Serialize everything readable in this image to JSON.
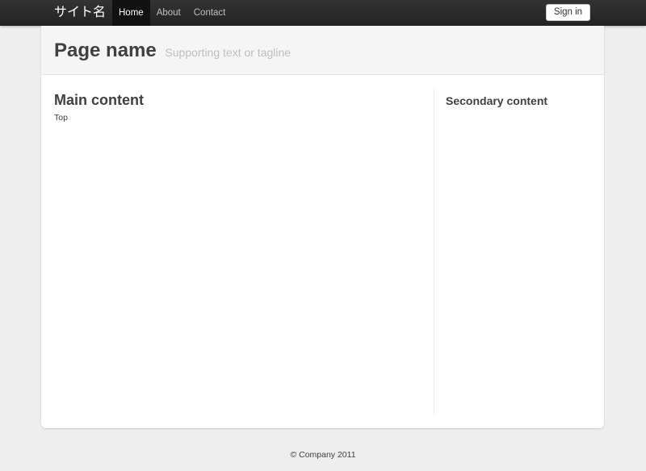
{
  "topbar": {
    "brand": "サイト名",
    "nav": [
      {
        "label": "Home",
        "active": true
      },
      {
        "label": "About",
        "active": false
      },
      {
        "label": "Contact",
        "active": false
      }
    ],
    "signin_label": "Sign in"
  },
  "page_header": {
    "title": "Page name",
    "tagline": "Supporting text or tagline"
  },
  "main": {
    "heading": "Main content",
    "text": "Top"
  },
  "secondary": {
    "heading": "Secondary content"
  },
  "footer": {
    "text": "© Company 2011"
  }
}
